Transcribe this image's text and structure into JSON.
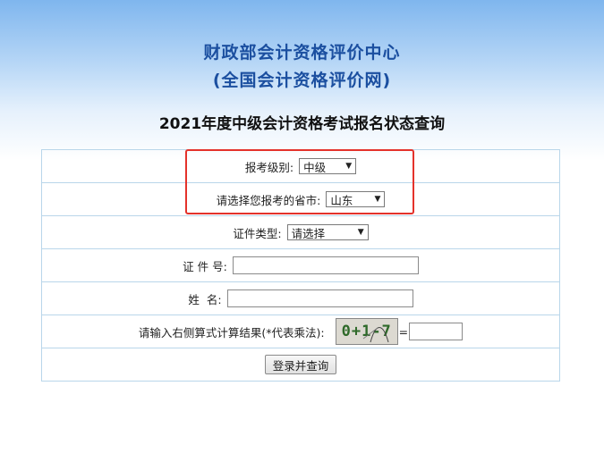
{
  "header": {
    "org_name": "财政部会计资格评价中心",
    "org_sub": "(全国会计资格评价网)"
  },
  "page_title": "2021年度中级会计资格考试报名状态查询",
  "form": {
    "level_label": "报考级别:",
    "level_value": "中级",
    "province_label": "请选择您报考的省市:",
    "province_value": "山东",
    "id_type_label": "证件类型:",
    "id_type_value": "请选择",
    "id_number_label": "证 件 号:",
    "id_number_value": "",
    "name_label": "姓  名:",
    "name_value": "",
    "captcha_label": "请输入右侧算式计算结果(*代表乘法):",
    "captcha_text": "0+1-7",
    "equals": "=",
    "captcha_value": "",
    "submit_label": "登录并查询"
  },
  "colors": {
    "org_title": "#1b4fa0",
    "border": "#b9d6ea",
    "highlight": "#e4322b"
  }
}
